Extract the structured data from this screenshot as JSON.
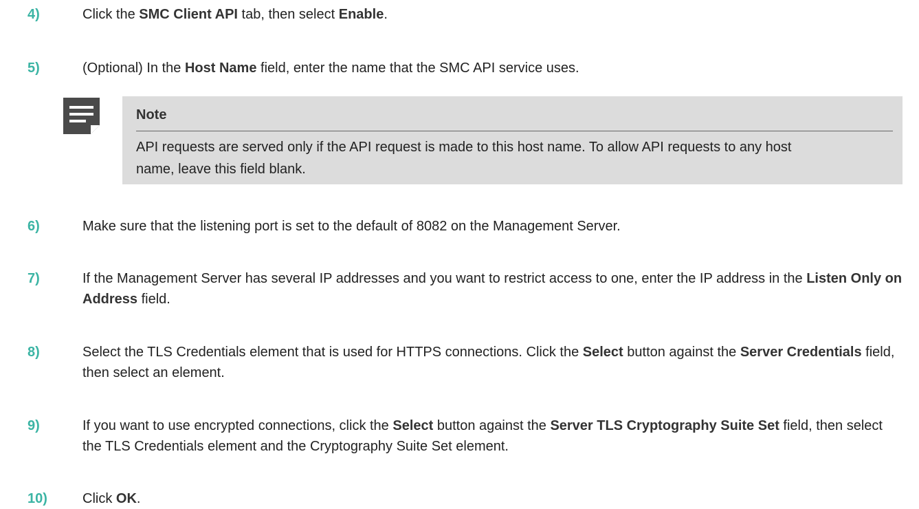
{
  "steps": [
    {
      "num": "4)",
      "parts": [
        {
          "t": "Click the "
        },
        {
          "t": "SMC Client API",
          "b": true
        },
        {
          "t": " tab, then select "
        },
        {
          "t": "Enable",
          "b": true
        },
        {
          "t": "."
        }
      ]
    },
    {
      "num": "5)",
      "parts": [
        {
          "t": "(Optional) In the "
        },
        {
          "t": "Host Name",
          "b": true
        },
        {
          "t": " field, enter the name that the SMC API service uses."
        }
      ]
    },
    {
      "num": "6)",
      "parts": [
        {
          "t": "Make sure that the listening port is set to the default of 8082 on the Management Server."
        }
      ]
    },
    {
      "num": "7)",
      "parts": [
        {
          "t": "If the Management Server has several IP addresses and you want to restrict access to one, enter the IP address in the "
        },
        {
          "t": "Listen Only on Address",
          "b": true
        },
        {
          "t": " field."
        }
      ]
    },
    {
      "num": "8)",
      "parts": [
        {
          "t": "Select the TLS Credentials element that is used for HTTPS connections. Click the "
        },
        {
          "t": "Select",
          "b": true
        },
        {
          "t": " button against the "
        },
        {
          "t": "Server Credentials",
          "b": true
        },
        {
          "t": " field, then select an element."
        }
      ]
    },
    {
      "num": "9)",
      "parts": [
        {
          "t": "If you want to use encrypted connections, click the "
        },
        {
          "t": "Select",
          "b": true
        },
        {
          "t": " button against the "
        },
        {
          "t": "Server TLS Cryptography Suite Set",
          "b": true
        },
        {
          "t": " field, then select the TLS Credentials element and the Cryptography Suite Set element."
        }
      ]
    },
    {
      "num": "10)",
      "parts": [
        {
          "t": "Click "
        },
        {
          "t": "OK",
          "b": true
        },
        {
          "t": "."
        }
      ]
    }
  ],
  "note": {
    "icon": "note-icon",
    "title": "Note",
    "body": "API requests are served only if the API request is made to this host name. To allow API requests to any host name, leave this field blank."
  },
  "colors": {
    "step_number": "#3bb4a4",
    "note_background": "#dcdcdc",
    "note_icon": "#4a4a4a"
  }
}
